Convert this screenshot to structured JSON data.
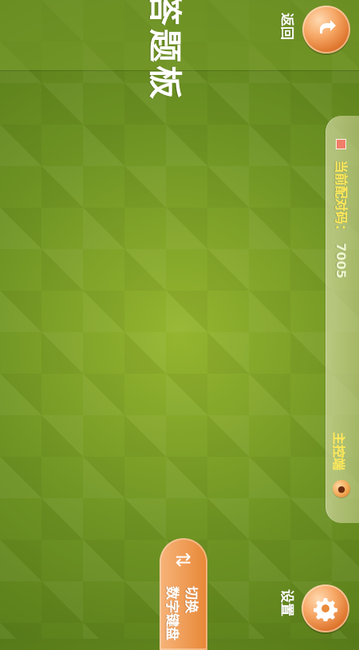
{
  "header": {
    "title": "答题板",
    "back_label": "返回"
  },
  "controls": {
    "settings_label": "设置",
    "switch_line_1": "切换",
    "switch_line_2": "数字键盘"
  },
  "status_panel": {
    "pair_code_label": "当前配对码：",
    "pair_code_value": "7005",
    "host_label": "主控端"
  },
  "icons": {
    "back": "back-arrow-icon",
    "settings": "gear-icon",
    "switch": "switch-arrows-icon",
    "host": "host-icon"
  },
  "colors": {
    "accent_orange": "#e98b3c",
    "panel_tint": "#c8d08e",
    "label_yellow": "#ffe95a"
  }
}
